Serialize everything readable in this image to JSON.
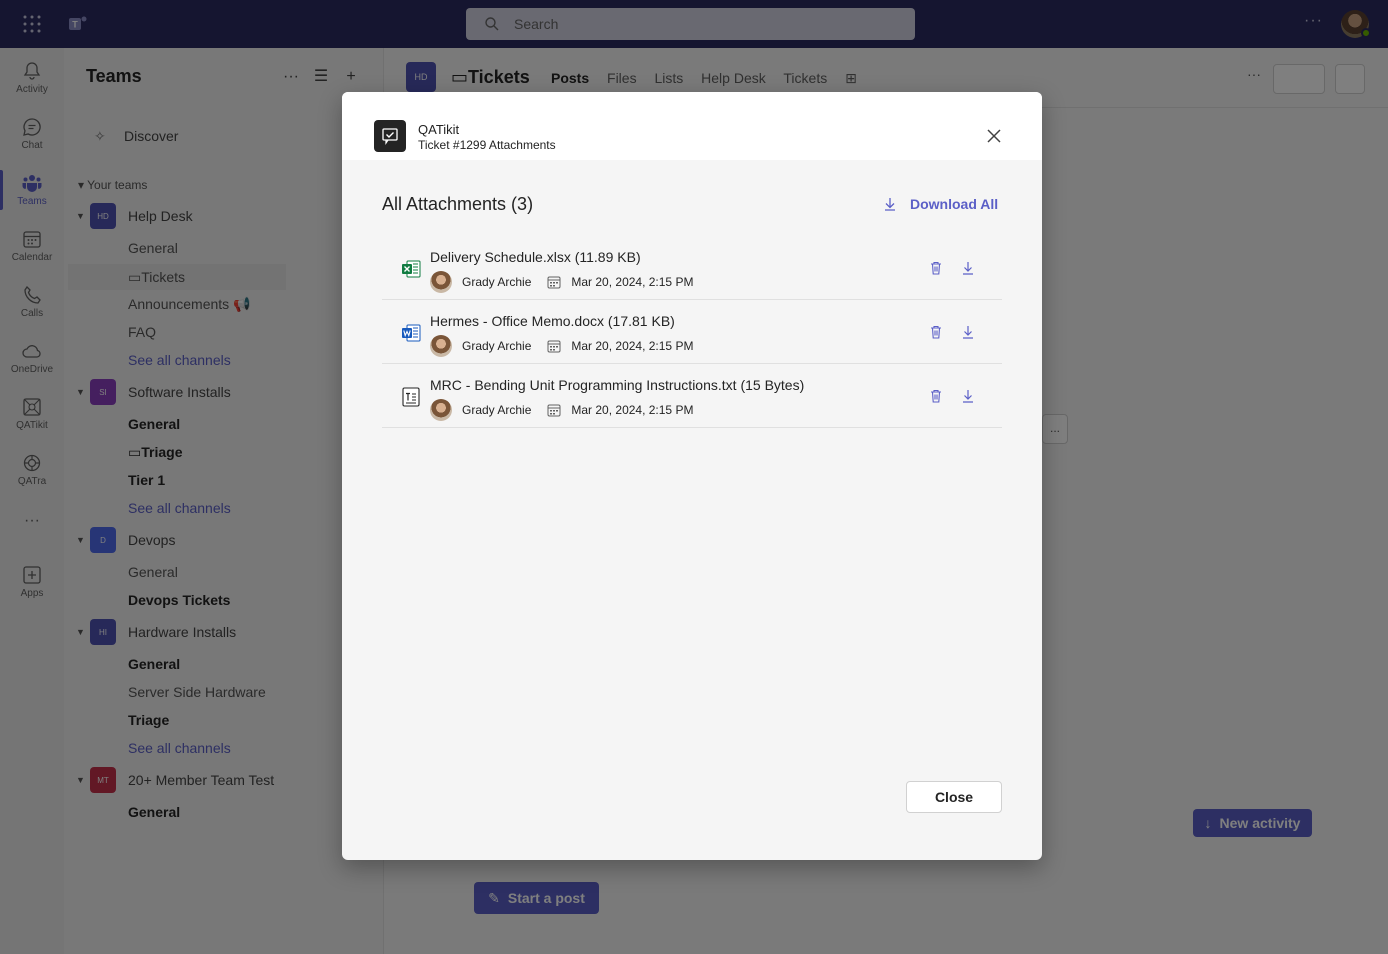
{
  "titlebar": {
    "search_placeholder": "Search",
    "more": "···"
  },
  "rail": {
    "items": [
      {
        "label": "Activity",
        "icon": "bell-icon"
      },
      {
        "label": "Chat",
        "icon": "chat-icon"
      },
      {
        "label": "Teams",
        "icon": "teams-icon"
      },
      {
        "label": "Calendar",
        "icon": "calendar-icon"
      },
      {
        "label": "Calls",
        "icon": "phone-icon"
      },
      {
        "label": "OneDrive",
        "icon": "cloud-icon"
      },
      {
        "label": "QATikit",
        "icon": "qatikit-icon"
      },
      {
        "label": "QATra",
        "icon": "qatra-icon"
      },
      {
        "label": "Apps",
        "icon": "add-app-icon"
      }
    ],
    "more": "···"
  },
  "teams_panel": {
    "title": "Teams",
    "discover": "Discover",
    "your_teams": "Your teams",
    "teams": [
      {
        "badge": "HD",
        "name": "Help Desk",
        "color": "#4f52b2",
        "channels": [
          "General",
          "Tickets",
          "Announcements",
          "FAQ",
          "See all channels"
        ]
      },
      {
        "badge": "SI",
        "name": "Software Installs",
        "color": "#8a3fbf",
        "channels": [
          "General",
          "Triage",
          "Tier 1",
          "See all channels"
        ]
      },
      {
        "badge": "D",
        "name": "Devops",
        "color": "#4f6bed",
        "channels": [
          "General",
          "Devops Tickets"
        ]
      },
      {
        "badge": "HI",
        "name": "Hardware Installs",
        "color": "#4f52b2",
        "channels": [
          "General",
          "Server Side Hardware",
          "Triage",
          "See all channels"
        ]
      },
      {
        "badge": "MT",
        "name": "20+ Member Team Test",
        "color": "#c4314b",
        "channels": [
          "General"
        ]
      }
    ]
  },
  "channel_header": {
    "badge": "HD",
    "title": "Tickets",
    "tabs": [
      "Posts",
      "Files",
      "Lists",
      "Help Desk",
      "Tickets"
    ],
    "more": "···",
    "ellipsis": "..."
  },
  "background_buttons": {
    "new_activity": "New activity",
    "start_post": "Start a post"
  },
  "modal": {
    "app_name": "QATikit",
    "subtitle": "Ticket #1299 Attachments",
    "heading": "All Attachments (3)",
    "download_all": "Download All",
    "close_label": "Close",
    "attachments": [
      {
        "file": "Delivery Schedule.xlsx (11.89 KB)",
        "type": "excel",
        "user": "Grady Archie",
        "date": "Mar 20, 2024, 2:15 PM"
      },
      {
        "file": "Hermes - Office Memo.docx (17.81 KB)",
        "type": "word",
        "user": "Grady Archie",
        "date": "Mar 20, 2024, 2:15 PM"
      },
      {
        "file": "MRC - Bending Unit Programming Instructions.txt (15 Bytes)",
        "type": "text",
        "user": "Grady Archie",
        "date": "Mar 20, 2024, 2:15 PM"
      }
    ]
  },
  "colors": {
    "brand": "#5b5fc7",
    "titlebar": "#2b2b61",
    "excel": "#107c41",
    "word": "#185abd"
  }
}
